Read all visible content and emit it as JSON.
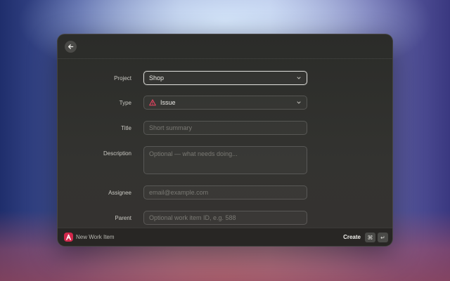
{
  "form": {
    "project": {
      "label": "Project",
      "value": "Shop"
    },
    "type": {
      "label": "Type",
      "value": "Issue"
    },
    "title": {
      "label": "Title",
      "placeholder": "Short summary"
    },
    "description": {
      "label": "Description",
      "placeholder": "Optional — what needs doing..."
    },
    "assignee": {
      "label": "Assignee",
      "placeholder": "email@example.com"
    },
    "parent": {
      "label": "Parent",
      "placeholder": "Optional work item ID, e.g. 588"
    }
  },
  "footer": {
    "title": "New Work Item",
    "create_label": "Create",
    "shortcut_mod": "⌘",
    "shortcut_key": "↵"
  },
  "icons": {
    "back": "arrow-left-icon",
    "issue": "warning-triangle-icon",
    "chevron": "chevron-down-icon",
    "logo": "app-logo-icon"
  },
  "colors": {
    "accent": "#d2274b",
    "issue_icon": "#e0445f"
  }
}
